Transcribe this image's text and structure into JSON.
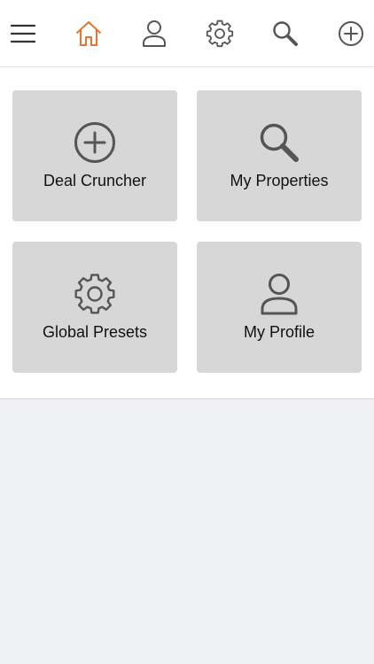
{
  "colors": {
    "accent": "#e8732a",
    "icon": "#555555",
    "tile_bg": "#d7d7d7",
    "page_bg": "#eff0f2"
  },
  "nav": {
    "items": [
      {
        "icon": "menu-icon"
      },
      {
        "icon": "home-icon",
        "active": true
      },
      {
        "icon": "user-icon"
      },
      {
        "icon": "gear-icon"
      },
      {
        "icon": "search-icon"
      },
      {
        "icon": "add-circle-icon"
      }
    ]
  },
  "tiles": [
    {
      "icon": "add-circle-icon",
      "label": "Deal Cruncher"
    },
    {
      "icon": "search-icon",
      "label": "My Properties"
    },
    {
      "icon": "gear-icon",
      "label": "Global Presets"
    },
    {
      "icon": "user-icon",
      "label": "My Profile"
    }
  ]
}
